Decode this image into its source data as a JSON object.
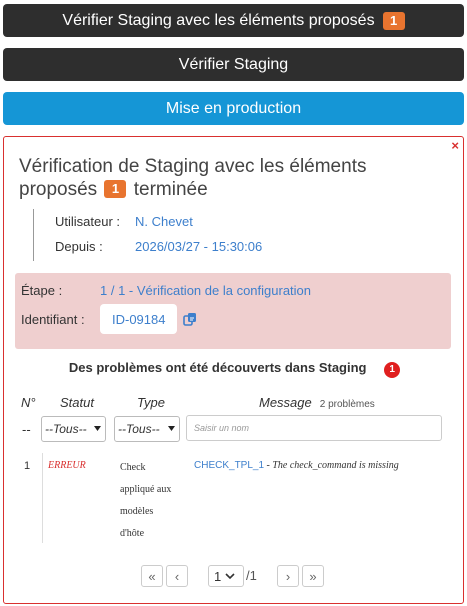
{
  "actions": {
    "verify_with_elements_label": "Vérifier Staging avec les éléments proposés",
    "verify_with_elements_count": "1",
    "verify_label": "Vérifier Staging",
    "deploy_label": "Mise en production"
  },
  "panel": {
    "close_symbol": "×",
    "title_before": "Vérification de Staging avec les éléments proposés",
    "title_count": "1",
    "title_after": "terminée",
    "meta": {
      "user_label": "Utilisateur :",
      "user_value": "N. Chevet",
      "since_label": "Depuis :",
      "since_value": "2026/03/27 - 15:30:06"
    },
    "step": {
      "step_label": "Étape :",
      "step_value": "1 / 1 - Vérification de la configuration",
      "id_label": "Identifiant :",
      "id_value": "ID-09184"
    },
    "problems": {
      "title": "Des problèmes ont été découverts dans Staging",
      "count": "1",
      "columns": {
        "num": "N°",
        "status": "Statut",
        "type": "Type",
        "message": "Message",
        "message_count": "2 problèmes"
      },
      "filters": {
        "num_dash": "--",
        "status_selected": "--Tous--",
        "type_selected": "--Tous--",
        "search_placeholder": "Saisir un nom"
      },
      "rows": [
        {
          "num": "1",
          "status": "ERREUR",
          "type_lines": [
            "Check",
            "appliqué aux",
            "modèles",
            "d'hôte"
          ],
          "code": "CHECK_TPL_1",
          "message": " - The check_command is missing"
        }
      ]
    },
    "pagination": {
      "first": "«",
      "prev": "‹",
      "page": "1",
      "total": "/1",
      "next": "›",
      "last": "»"
    }
  },
  "colors": {
    "dark_button": "#2e2e2e",
    "blue_button": "#1596d6",
    "orange_badge": "#e8742f",
    "red_badge": "#e01f1f",
    "panel_border": "#d9302f",
    "step_background": "#efcfcf",
    "link": "#3d7fcc"
  },
  "icons": [
    "close-icon",
    "copy-icon",
    "chevron-down-icon",
    "double-chevron-left-icon",
    "chevron-left-icon",
    "chevron-right-icon",
    "double-chevron-right-icon"
  ]
}
